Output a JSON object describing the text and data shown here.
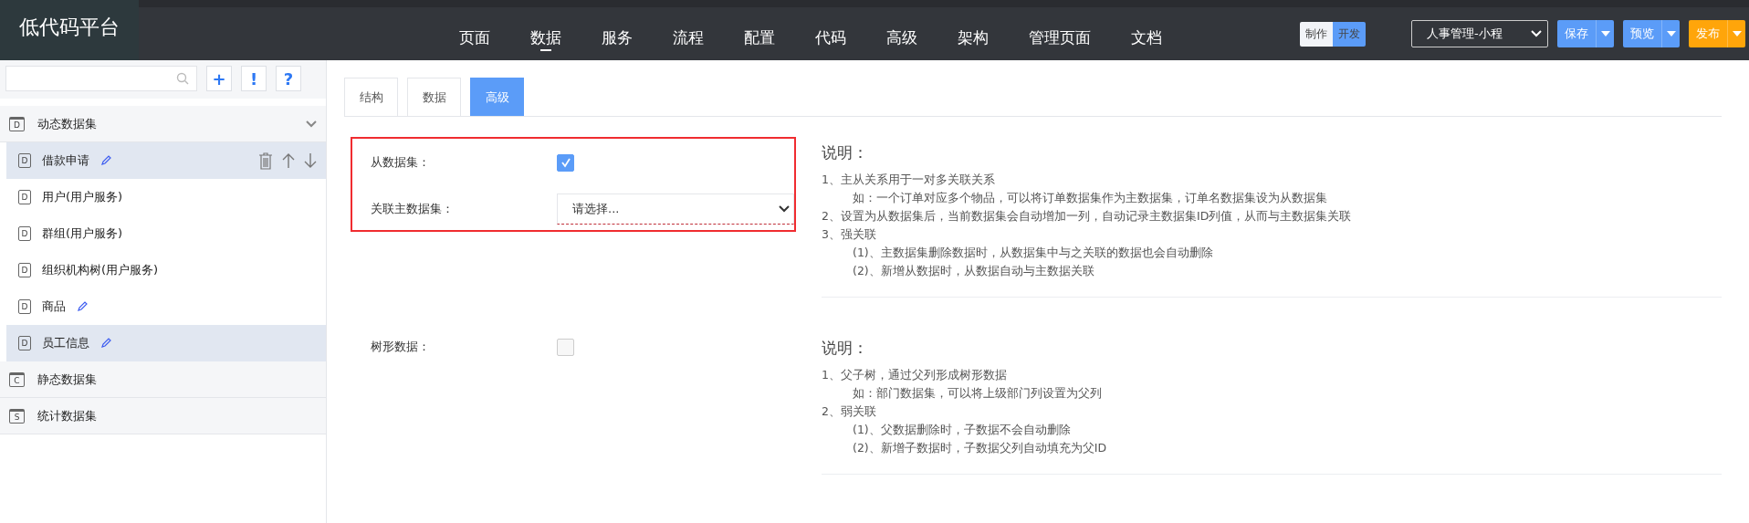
{
  "app_title": "低代码平台",
  "nav": [
    {
      "label": "页面",
      "selected": false
    },
    {
      "label": "数据",
      "selected": true
    },
    {
      "label": "服务",
      "selected": false
    },
    {
      "label": "流程",
      "selected": false
    },
    {
      "label": "配置",
      "selected": false
    },
    {
      "label": "代码",
      "selected": false
    },
    {
      "label": "高级",
      "selected": false
    },
    {
      "label": "架构",
      "selected": false
    },
    {
      "label": "管理页面",
      "selected": false
    },
    {
      "label": "文档",
      "selected": false
    }
  ],
  "mode_toggle": [
    {
      "label": "制作",
      "selected": false
    },
    {
      "label": "开发",
      "selected": true
    }
  ],
  "project_select": {
    "value": "人事管理-小程"
  },
  "action_buttons": [
    {
      "label": "保存",
      "color": "#5b9cf8"
    },
    {
      "label": "预览",
      "color": "#5b9cf8"
    },
    {
      "label": "发布",
      "color": "#ffa50a"
    }
  ],
  "sidebar": {
    "tool_buttons": [
      "+",
      "!",
      "?"
    ],
    "groups": [
      {
        "label": "动态数据集",
        "icon_letter": "D",
        "expanded": true,
        "children": [
          {
            "label": "借款申请",
            "icon_letter": "D",
            "editable": true,
            "selected": true,
            "show_actions": true
          },
          {
            "label": "用户(用户服务)",
            "icon_letter": "D",
            "editable": false,
            "selected": false,
            "show_actions": false
          },
          {
            "label": "群组(用户服务)",
            "icon_letter": "D",
            "editable": false,
            "selected": false,
            "show_actions": false
          },
          {
            "label": "组织机构树(用户服务)",
            "icon_letter": "D",
            "editable": false,
            "selected": false,
            "show_actions": false
          },
          {
            "label": "商品",
            "icon_letter": "D",
            "editable": true,
            "selected": false,
            "show_actions": false
          },
          {
            "label": "员工信息",
            "icon_letter": "D",
            "editable": true,
            "selected": true,
            "show_actions": false
          }
        ]
      },
      {
        "label": "静态数据集",
        "icon_letter": "C",
        "expanded": false
      },
      {
        "label": "统计数据集",
        "icon_letter": "S",
        "expanded": false
      }
    ]
  },
  "tabs": [
    {
      "label": "结构",
      "selected": false
    },
    {
      "label": "数据",
      "selected": false
    },
    {
      "label": "高级",
      "selected": true
    }
  ],
  "sections": [
    {
      "highlighted": true,
      "fields": [
        {
          "kind": "checkbox",
          "label": "从数据集：",
          "checked": true
        },
        {
          "kind": "select",
          "label": "关联主数据集：",
          "placeholder": "请选择...",
          "invalid": true
        }
      ],
      "note": {
        "title": "说明：",
        "items": [
          {
            "text": "1、主从关系用于一对多关联关系",
            "children": [
              {
                "text": "如：一个订单对应多个物品，可以将订单数据集作为主数据集，订单名数据集设为从数据集"
              }
            ]
          },
          {
            "text": "2、设置为从数据集后，当前数据集会自动增加一列，自动记录主数据集ID列值，从而与主数据集关联"
          },
          {
            "text": "3、强关联",
            "children": [
              {
                "text": "(1)、主数据集删除数据时，从数据集中与之关联的数据也会自动删除"
              },
              {
                "text": "(2)、新增从数据时，从数据自动与主数据关联"
              }
            ]
          }
        ]
      }
    },
    {
      "highlighted": false,
      "fields": [
        {
          "kind": "checkbox",
          "label": "树形数据：",
          "checked": false
        }
      ],
      "note": {
        "title": "说明：",
        "items": [
          {
            "text": "1、父子树，通过父列形成树形数据",
            "children": [
              {
                "text": "如：部门数据集，可以将上级部门列设置为父列"
              }
            ]
          },
          {
            "text": "2、弱关联",
            "children": [
              {
                "text": "(1)、父数据删除时，子数据不会自动删除"
              },
              {
                "text": "(2)、新增子数据时，子数据父列自动填充为父ID"
              }
            ]
          }
        ]
      }
    }
  ]
}
